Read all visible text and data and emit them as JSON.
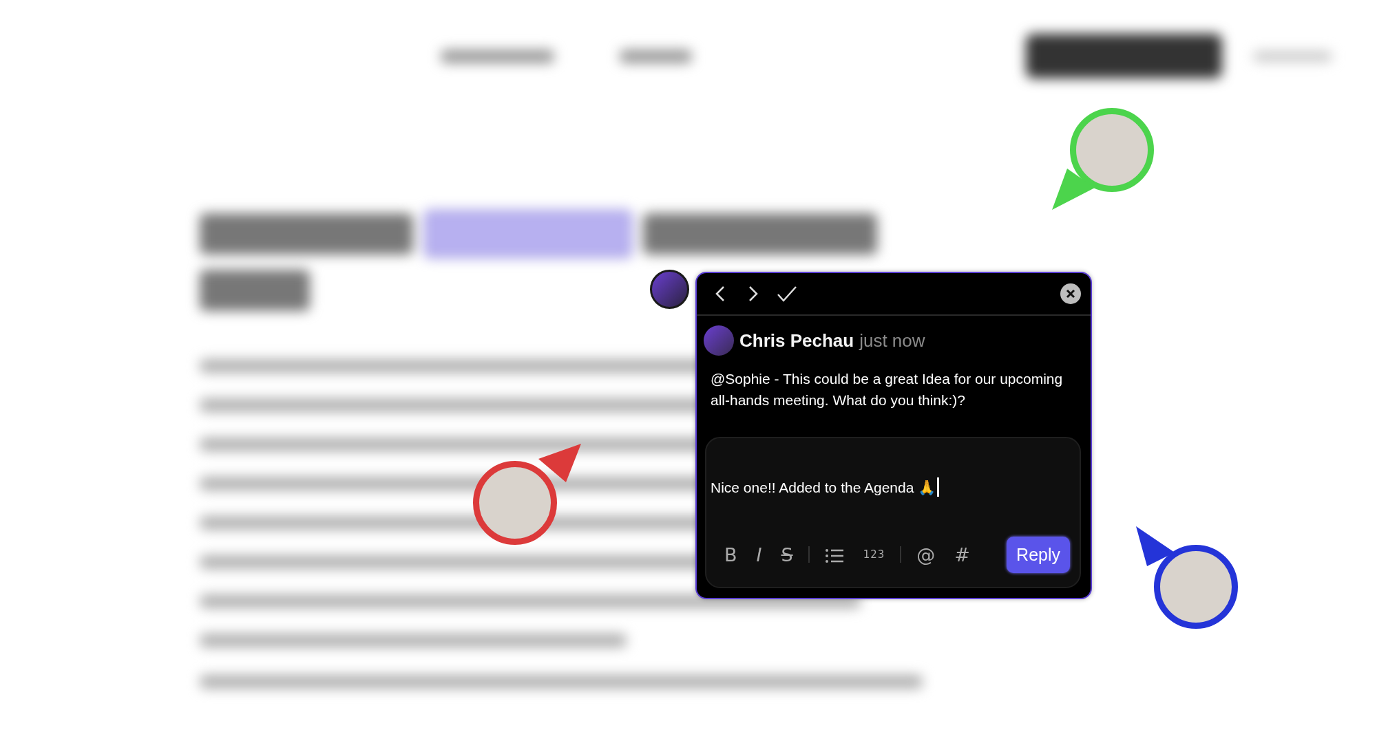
{
  "collaborators": [
    {
      "color": "#4cd44c"
    },
    {
      "color": "#dc3a3a"
    },
    {
      "color": "#2434d8"
    }
  ],
  "comment_popover": {
    "comment": {
      "author": "Chris Pechau",
      "time": "just now",
      "text": "@Sophie - This could be a great Idea for our upcoming all-hands meeting. What do you think:)?"
    },
    "reply": {
      "value": "Nice one!! Added to the Agenda 🙏",
      "toolbar": [
        {
          "kind": "bold",
          "label": "B"
        },
        {
          "kind": "italic",
          "label": "I"
        },
        {
          "kind": "strike",
          "label": "S"
        },
        {
          "kind": "separator"
        },
        {
          "kind": "bullet-list"
        },
        {
          "kind": "numbered-list",
          "label": "123"
        },
        {
          "kind": "separator"
        },
        {
          "kind": "mention",
          "label": "@"
        },
        {
          "kind": "tag",
          "label": "#"
        }
      ],
      "button": "Reply"
    }
  }
}
